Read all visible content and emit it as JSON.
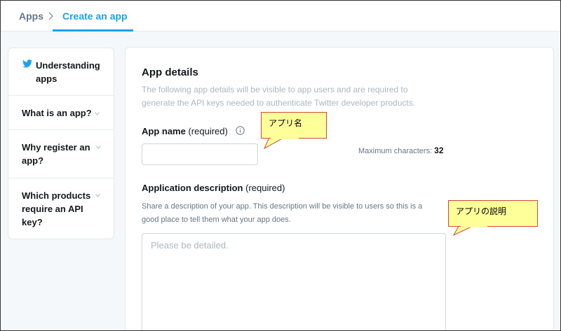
{
  "breadcrumb": {
    "root": "Apps",
    "current": "Create an app"
  },
  "sidebar": {
    "items": [
      {
        "label": "Understanding apps",
        "icon": "twitter-bird-icon"
      },
      {
        "label": "What is an app?",
        "icon": "chevron-down-icon"
      },
      {
        "label": "Why register an app?",
        "icon": "chevron-down-icon"
      },
      {
        "label": "Which products require an API key?",
        "icon": "chevron-down-icon"
      }
    ]
  },
  "form": {
    "section_title": "App details",
    "section_desc": "The following app details will be visible to app users and are required to generate the API keys needed to authenticate Twitter developer products.",
    "app_name": {
      "label": "App name",
      "required": "(required)",
      "value": "",
      "max_label": "Maximum characters:",
      "max_value": "32"
    },
    "description": {
      "label": "Application description",
      "required": "(required)",
      "help": "Share a description of your app. This description will be visible to users so this is a good place to tell them what your app does.",
      "placeholder": "Please be detailed.",
      "value": ""
    }
  },
  "annotations": {
    "app_name_note": "アプリ名",
    "description_note": "アプリの説明"
  },
  "colors": {
    "accent": "#1da1f2",
    "callout_fill": "#ffff99",
    "callout_border": "#d04a3a"
  }
}
